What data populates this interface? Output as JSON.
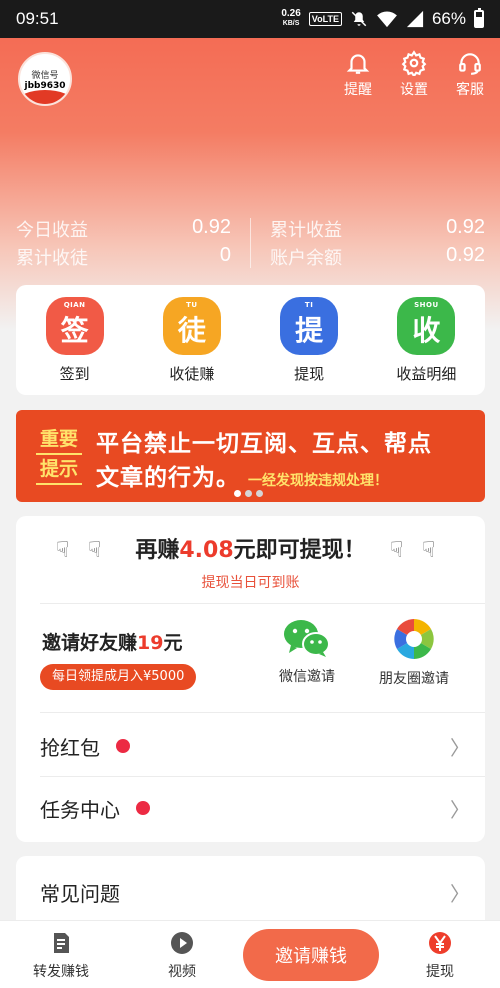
{
  "status_bar": {
    "time": "09:51",
    "speed_value": "0.26",
    "speed_unit": "KB/S",
    "volte": "VoLTE",
    "battery": "66%",
    "battery_level": 0.66
  },
  "header": {
    "avatar_line1": "微信号",
    "avatar_line2": "jbb9630",
    "actions": [
      {
        "label": "提醒",
        "icon": "bell-icon"
      },
      {
        "label": "设置",
        "icon": "gear-icon"
      },
      {
        "label": "客服",
        "icon": "headset-icon"
      }
    ]
  },
  "stats": {
    "today_label": "今日收益",
    "today_value": "0.92",
    "total_income_label": "累计收益",
    "total_income_value": "0.92",
    "apprentice_label": "累计收徒",
    "apprentice_value": "0",
    "balance_label": "账户余额",
    "balance_value": "0.92"
  },
  "quick_actions": [
    {
      "label": "签到",
      "glyph": "签",
      "tiny": "QIAN",
      "color": "#f15a46"
    },
    {
      "label": "收徒赚",
      "glyph": "徒",
      "tiny": "TU",
      "color": "#f6a623"
    },
    {
      "label": "提现",
      "glyph": "提",
      "tiny": "TI",
      "color": "#3a6fe0"
    },
    {
      "label": "收益明细",
      "glyph": "收",
      "tiny": "SHOU",
      "color": "#3cb84a"
    }
  ],
  "banner": {
    "tag_line1": "重要",
    "tag_line2": "提示",
    "line1": "平台禁止一切互阅、互点、帮点",
    "line2": "文章的行为。",
    "line2_small": "一经发现按违规处理！"
  },
  "earn": {
    "prefix": "再赚",
    "amount": "4.08",
    "suffix": "元即可提现！",
    "subtitle": "提现当日可到账",
    "invite_title_prefix": "邀请好友赚",
    "invite_title_amount": "19",
    "invite_title_suffix": "元",
    "invite_pill": "每日领提成月入¥5000",
    "share_wechat": "微信邀请",
    "share_moments": "朋友圈邀请",
    "red_packet": "抢红包",
    "task_center": "任务中心"
  },
  "faq": {
    "label": "常见问题"
  },
  "bottom_nav": {
    "repost": "转发赚钱",
    "video": "视频",
    "invite": "邀请赚钱",
    "withdraw": "提现"
  },
  "colors": {
    "accent": "#e84a22",
    "red_text": "#ec3b2c",
    "hero_top": "#f4664f"
  }
}
